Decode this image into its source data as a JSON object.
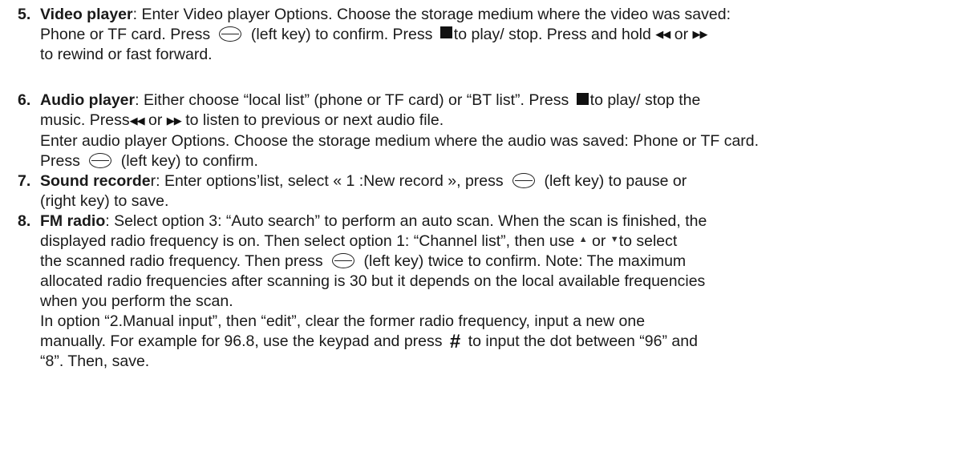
{
  "items": [
    {
      "number": "5.",
      "term": "Video player",
      "lines": [
        {
          "a": ": Enter Video player Options. Choose the storage medium where the video was saved:"
        },
        {
          "a": "Phone or TF card. Press",
          "b": "(left key) to confirm. Press",
          "c": "to play/ stop. Press and hold",
          "d": "or",
          "e": ""
        },
        {
          "a": "to rewind or fast forward."
        }
      ]
    },
    {
      "number": "6.",
      "term": "Audio player",
      "lines": [
        {
          "a": ": Either choose “local list” (phone or TF card) or “BT list”. Press",
          "b": "to play/ stop the"
        },
        {
          "a": "music. Press",
          "b": "or",
          "c": "to listen to previous or next audio file."
        },
        {
          "a": "Enter audio player Options. Choose the storage medium where the audio was saved: Phone or TF card."
        },
        {
          "a": "Press",
          "b": "(left key) to confirm."
        }
      ]
    },
    {
      "number": "7.",
      "term": "Sound recorde",
      "term_tail": "r",
      "lines": [
        {
          "a": ": Enter options’list, select « 1 :New record », press",
          "b": "(left key) to pause or"
        },
        {
          "a": "(right key) to save."
        }
      ]
    },
    {
      "number": "8.",
      "term": "FM radio",
      "lines": [
        {
          "a": ": Select option 3: “Auto search” to perform an auto scan. When the scan is finished, the"
        },
        {
          "a": "displayed radio frequency is on. Then select option 1: “Channel list”, then use",
          "b": "or",
          "c": "to select"
        },
        {
          "a": "the scanned radio frequency. Then press",
          "b": "(left key) twice to confirm. Note: The maximum"
        },
        {
          "a": "allocated radio frequencies after scanning is 30 but it depends on the local available frequencies"
        },
        {
          "a": "when you perform the scan."
        },
        {
          "a": "In option “2.Manual input”, then “edit”, clear the former radio frequency, input a new one"
        },
        {
          "a": "manually. For example for 96.8, use the keypad and press",
          "b": "to input the dot between “96” and"
        },
        {
          "a": "“8”. Then, save."
        }
      ]
    }
  ],
  "icons": {
    "left_key": "oval-key-icon",
    "stop": "stop-square-icon",
    "rewind": "rewind-icon",
    "forward": "fast-forward-icon",
    "up": "up-arrow-icon",
    "down": "down-arrow-icon",
    "hash": "hash-icon"
  },
  "glyphs": {
    "rewind": "◀◀",
    "forward": "▶▶",
    "up": "▲",
    "down": "▼",
    "hash": "#"
  }
}
